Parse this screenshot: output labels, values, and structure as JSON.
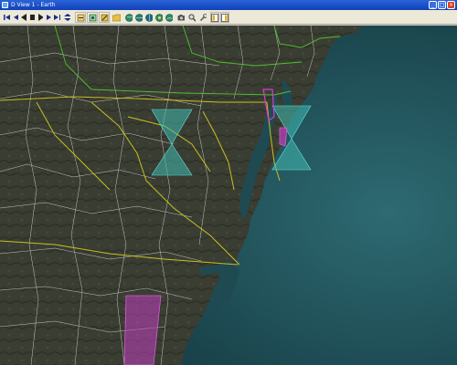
{
  "window": {
    "title": "D View 1 - Earth"
  },
  "title_buttons": [
    "minimize",
    "maximize",
    "close"
  ],
  "toolbar": {
    "buttons": [
      {
        "name": "first-frame",
        "icon": "first-frame-icon"
      },
      {
        "name": "step-back",
        "icon": "step-back-icon"
      },
      {
        "name": "play-backward",
        "icon": "play-backward-icon"
      },
      {
        "name": "stop",
        "icon": "stop-icon"
      },
      {
        "name": "play-forward",
        "icon": "play-forward-icon"
      },
      {
        "name": "step-forward",
        "icon": "step-forward-icon"
      },
      {
        "name": "last-frame",
        "icon": "last-frame-icon"
      },
      {
        "name": "loop",
        "icon": "loop-icon"
      },
      {
        "name": "zoom",
        "icon": "zoom-icon"
      },
      {
        "name": "pan",
        "icon": "pan-icon"
      },
      {
        "name": "rotate",
        "icon": "rotate-icon"
      },
      {
        "name": "open-file",
        "icon": "folder-icon"
      },
      {
        "name": "globe-1",
        "icon": "globe-icon"
      },
      {
        "name": "globe-2",
        "icon": "globe-icon"
      },
      {
        "name": "globe-3",
        "icon": "globe-icon"
      },
      {
        "name": "globe-4",
        "icon": "globe-icon"
      },
      {
        "name": "globe-5",
        "icon": "globe-icon"
      },
      {
        "name": "camera",
        "icon": "camera-icon"
      },
      {
        "name": "magnify",
        "icon": "magnifier-icon"
      },
      {
        "name": "settings",
        "icon": "wrench-icon"
      },
      {
        "name": "panel-left",
        "icon": "panel-left-icon"
      },
      {
        "name": "panel-right",
        "icon": "panel-right-icon"
      }
    ]
  },
  "map": {
    "colors": {
      "ocean": "#1c4f57",
      "land": "#3a3d32",
      "state_border_yellow": "#c8c020",
      "state_border_green": "#50c030",
      "county_border_white": "#e8e8e8",
      "overlay_cyan": "#3fb9b0",
      "overlay_magenta": "#c040c0"
    }
  }
}
